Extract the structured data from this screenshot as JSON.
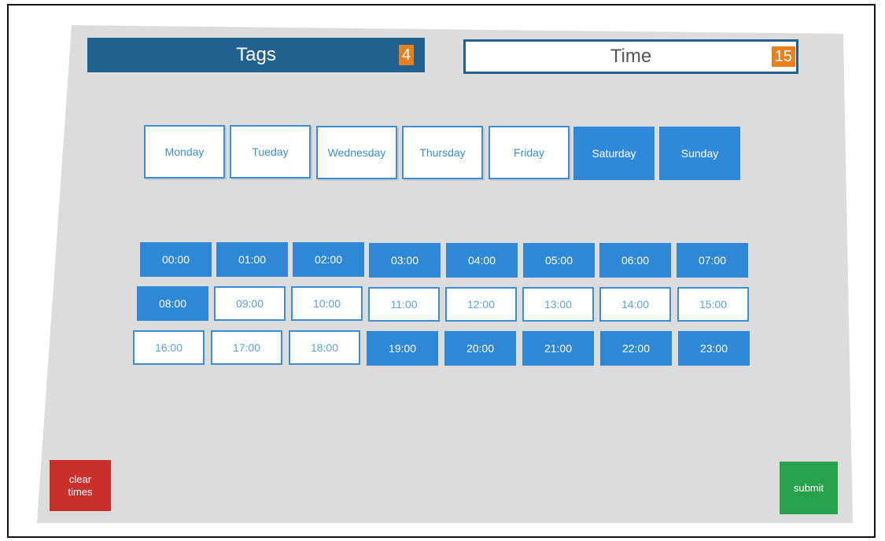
{
  "header": {
    "tags_label": "Tags",
    "tags_count": "4",
    "time_label": "Time",
    "time_count": "15"
  },
  "colors": {
    "panel": "#dcdcdc",
    "tags_tab": "#21618f",
    "selected": "#3089d8",
    "badge": "#e8801e",
    "clear": "#c9302c",
    "submit": "#27a14b"
  },
  "days": [
    {
      "label": "Monday",
      "selected": false
    },
    {
      "label": "Tueday",
      "selected": false
    },
    {
      "label": "Wednesday",
      "selected": false
    },
    {
      "label": "Thursday",
      "selected": false
    },
    {
      "label": "Friday",
      "selected": false
    },
    {
      "label": "Saturday",
      "selected": true
    },
    {
      "label": "Sunday",
      "selected": true
    }
  ],
  "times": [
    {
      "label": "00:00",
      "selected": true
    },
    {
      "label": "01:00",
      "selected": true
    },
    {
      "label": "02:00",
      "selected": true
    },
    {
      "label": "03:00",
      "selected": true
    },
    {
      "label": "04:00",
      "selected": true
    },
    {
      "label": "05:00",
      "selected": true
    },
    {
      "label": "06:00",
      "selected": true
    },
    {
      "label": "07:00",
      "selected": true
    },
    {
      "label": "08:00",
      "selected": true
    },
    {
      "label": "09:00",
      "selected": false
    },
    {
      "label": "10:00",
      "selected": false
    },
    {
      "label": "11:00",
      "selected": false
    },
    {
      "label": "12:00",
      "selected": false
    },
    {
      "label": "13:00",
      "selected": false
    },
    {
      "label": "14:00",
      "selected": false
    },
    {
      "label": "15:00",
      "selected": false
    },
    {
      "label": "16:00",
      "selected": false
    },
    {
      "label": "17:00",
      "selected": false
    },
    {
      "label": "18:00",
      "selected": false
    },
    {
      "label": "19:00",
      "selected": true
    },
    {
      "label": "20:00",
      "selected": true
    },
    {
      "label": "21:00",
      "selected": true
    },
    {
      "label": "22:00",
      "selected": true
    },
    {
      "label": "23:00",
      "selected": true
    }
  ],
  "buttons": {
    "clear_line1": "clear",
    "clear_line2": "times",
    "submit": "submit"
  }
}
